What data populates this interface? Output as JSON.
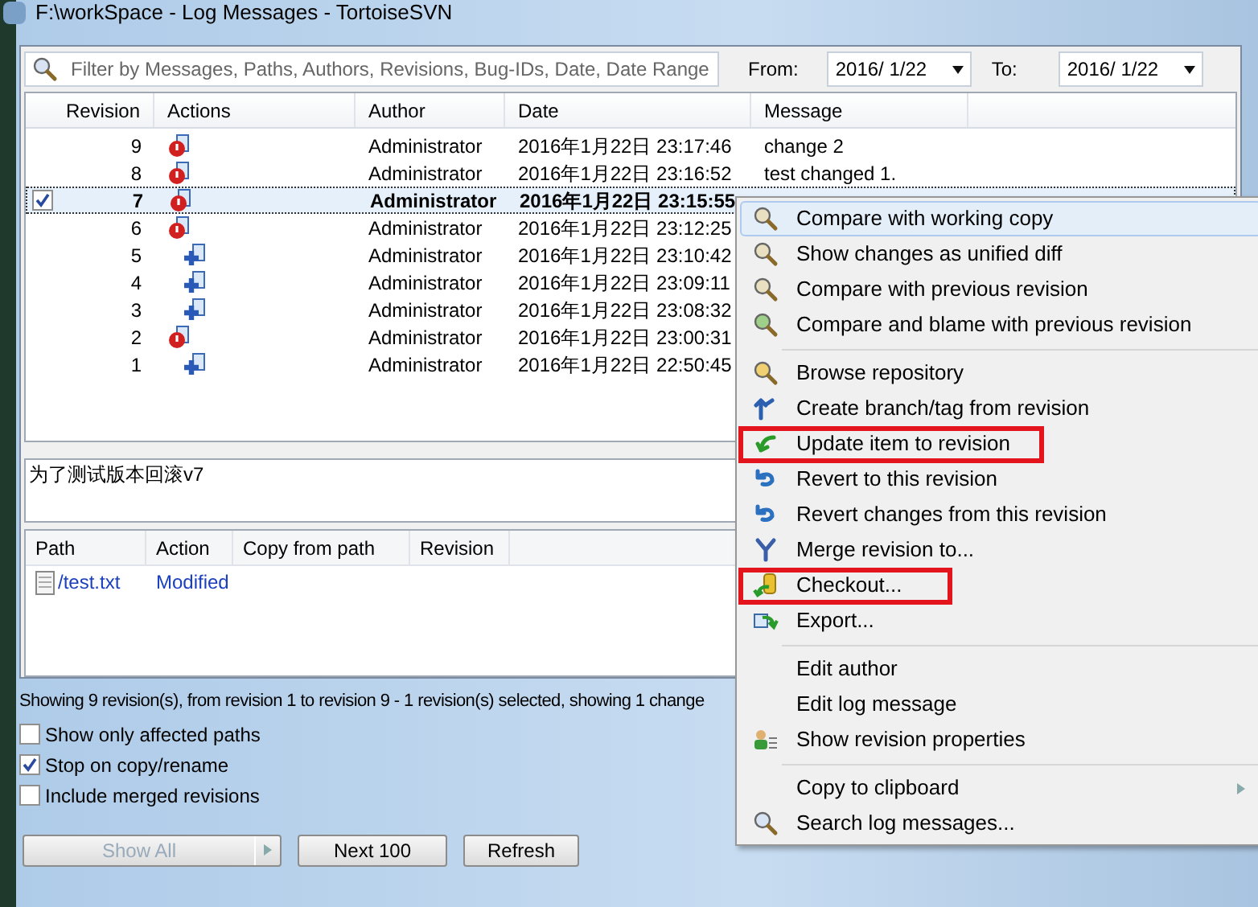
{
  "window": {
    "title": "F:\\workSpace - Log Messages - TortoiseSVN"
  },
  "filter": {
    "placeholder": "Filter by Messages, Paths, Authors, Revisions, Bug-IDs, Date, Date Range",
    "from_label": "From:",
    "from_value": "2016/  1/22",
    "to_label": "To:",
    "to_value": "2016/  1/22"
  },
  "log_table": {
    "columns": [
      "Revision",
      "Actions",
      "Author",
      "Date",
      "Message"
    ],
    "rows": [
      {
        "revision": "9",
        "kind": "modified",
        "author": "Administrator",
        "date": "2016年1月22日 23:17:46",
        "message": "change 2",
        "selected": false
      },
      {
        "revision": "8",
        "kind": "modified",
        "author": "Administrator",
        "date": "2016年1月22日 23:16:52",
        "message": "test changed 1.",
        "selected": false
      },
      {
        "revision": "7",
        "kind": "modified",
        "author": "Administrator",
        "date": "2016年1月22日 23:15:55",
        "selected": true
      },
      {
        "revision": "6",
        "kind": "modified",
        "author": "Administrator",
        "date": "2016年1月22日 23:12:25",
        "selected": false
      },
      {
        "revision": "5",
        "kind": "added",
        "author": "Administrator",
        "date": "2016年1月22日 23:10:42",
        "selected": false
      },
      {
        "revision": "4",
        "kind": "added",
        "author": "Administrator",
        "date": "2016年1月22日 23:09:11",
        "selected": false
      },
      {
        "revision": "3",
        "kind": "added",
        "author": "Administrator",
        "date": "2016年1月22日 23:08:32",
        "selected": false
      },
      {
        "revision": "2",
        "kind": "modified",
        "author": "Administrator",
        "date": "2016年1月22日 23:00:31",
        "selected": false
      },
      {
        "revision": "1",
        "kind": "added",
        "author": "Administrator",
        "date": "2016年1月22日 22:50:45",
        "selected": false
      }
    ]
  },
  "message_text": "为了测试版本回滚v7",
  "paths_table": {
    "columns": [
      "Path",
      "Action",
      "Copy from path",
      "Revision"
    ],
    "rows": [
      {
        "path": "/test.txt",
        "action": "Modified"
      }
    ]
  },
  "status_text": "Showing 9 revision(s), from revision 1 to revision 9 - 1 revision(s) selected, showing 1 change",
  "options": [
    {
      "label": "Show only affected paths",
      "checked": false
    },
    {
      "label": "Stop on copy/rename",
      "checked": true
    },
    {
      "label": "Include merged revisions",
      "checked": false
    }
  ],
  "buttons": [
    {
      "label": "Show All",
      "disabled": true,
      "split": true
    },
    {
      "label": "Next 100",
      "disabled": false,
      "split": false
    },
    {
      "label": "Refresh",
      "disabled": false,
      "split": false
    }
  ],
  "context_menu": [
    {
      "kind": "item",
      "label": "Compare with working copy",
      "selected": true,
      "marked": false,
      "submenu": false
    },
    {
      "kind": "item",
      "label": "Show changes as unified diff",
      "selected": false,
      "marked": false,
      "submenu": false
    },
    {
      "kind": "item",
      "label": "Compare with previous revision",
      "selected": false,
      "marked": false,
      "submenu": false
    },
    {
      "kind": "item",
      "label": "Compare and blame with previous revision",
      "selected": false,
      "marked": false,
      "submenu": false
    },
    {
      "kind": "separator"
    },
    {
      "kind": "item",
      "label": "Browse repository",
      "selected": false,
      "marked": false,
      "submenu": false
    },
    {
      "kind": "item",
      "label": "Create branch/tag from revision",
      "selected": false,
      "marked": false,
      "submenu": false
    },
    {
      "kind": "item",
      "label": "Update item to revision",
      "selected": false,
      "marked": true,
      "submenu": false
    },
    {
      "kind": "item",
      "label": "Revert to this revision",
      "selected": false,
      "marked": false,
      "submenu": false
    },
    {
      "kind": "item",
      "label": "Revert changes from this revision",
      "selected": false,
      "marked": false,
      "submenu": false
    },
    {
      "kind": "item",
      "label": "Merge revision to...",
      "selected": false,
      "marked": false,
      "submenu": false
    },
    {
      "kind": "item",
      "label": "Checkout...",
      "selected": false,
      "marked": true,
      "submenu": false
    },
    {
      "kind": "item",
      "label": "Export...",
      "selected": false,
      "marked": false,
      "submenu": false
    },
    {
      "kind": "separator"
    },
    {
      "kind": "item",
      "label": "Edit author",
      "selected": false,
      "marked": false,
      "submenu": false
    },
    {
      "kind": "item",
      "label": "Edit log message",
      "selected": false,
      "marked": false,
      "submenu": false
    },
    {
      "kind": "item",
      "label": "Show revision properties",
      "selected": false,
      "marked": false,
      "submenu": false
    },
    {
      "kind": "separator"
    },
    {
      "kind": "item",
      "label": "Copy to clipboard",
      "selected": false,
      "marked": false,
      "submenu": true
    },
    {
      "kind": "item",
      "label": "Search log messages...",
      "selected": false,
      "marked": false,
      "submenu": false
    }
  ]
}
